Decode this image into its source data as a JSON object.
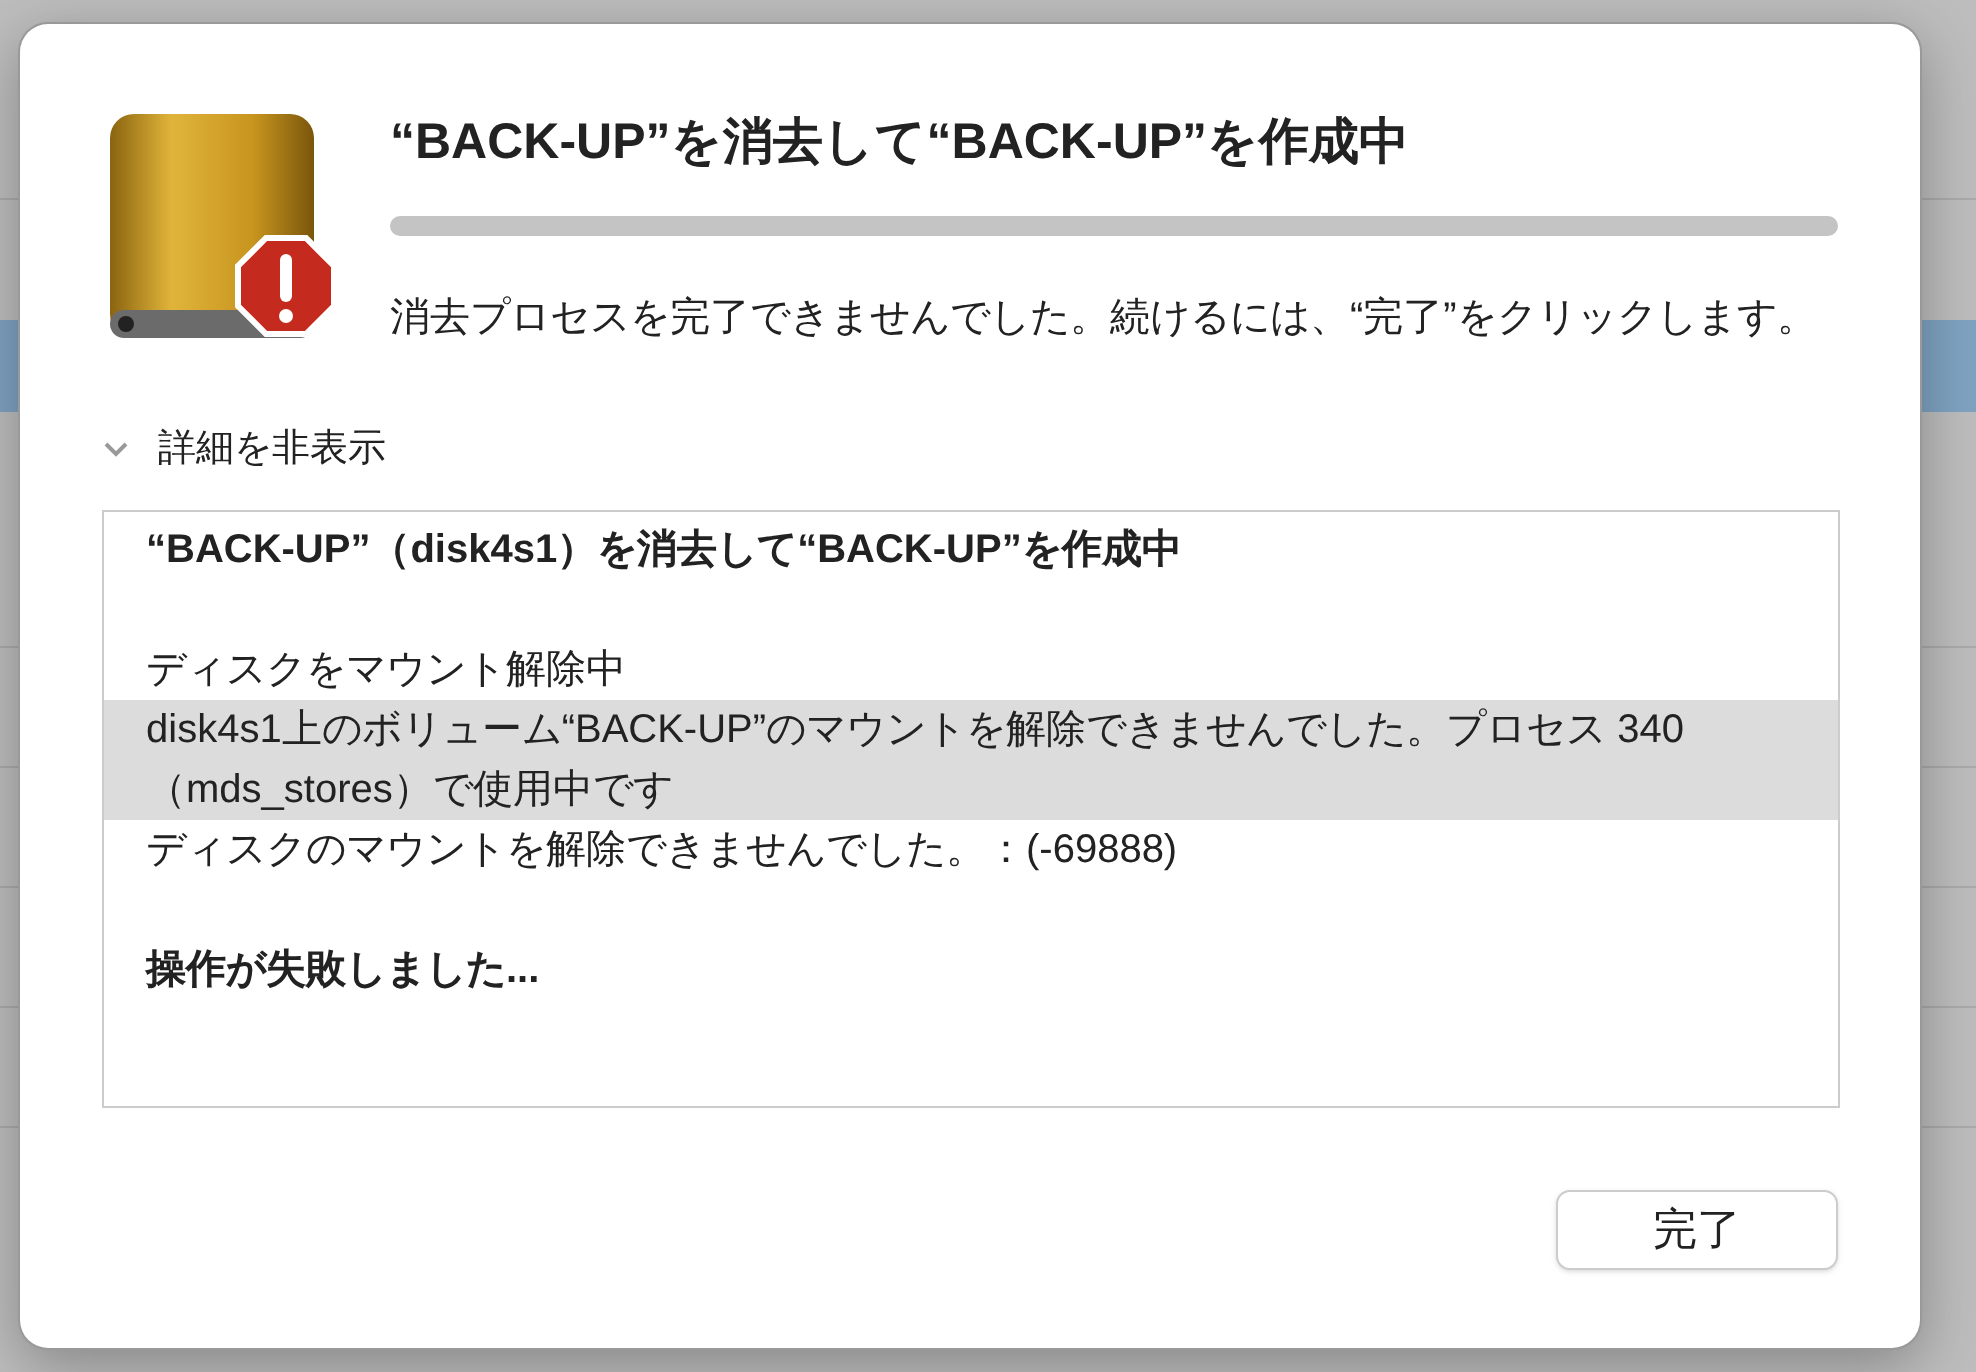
{
  "dialog": {
    "title": "“BACK-UP”を消去して“BACK-UP”を作成中",
    "message": "消去プロセスを完了できませんでした。続けるには、“完了”をクリックします。",
    "details_toggle": {
      "label": "詳細を非表示",
      "expanded": true
    },
    "log": [
      {
        "kind": "heading",
        "text": "“BACK-UP”（disk4s1）を消去して“BACK-UP”を作成中",
        "selected": false
      },
      {
        "kind": "message",
        "text": "ディスクをマウント解除中",
        "selected": false
      },
      {
        "kind": "message",
        "text": "disk4s1上のボリューム“BACK-UP”のマウントを解除できませんでした。プロセス 340（mds_stores）で使用中です",
        "selected": true
      },
      {
        "kind": "message",
        "text": "ディスクのマウントを解除できませんでした。：(-69888)",
        "selected": false
      },
      {
        "kind": "heading",
        "text": "操作が失敗しました...",
        "selected": false
      }
    ],
    "buttons": [
      {
        "label": "完了"
      }
    ]
  }
}
